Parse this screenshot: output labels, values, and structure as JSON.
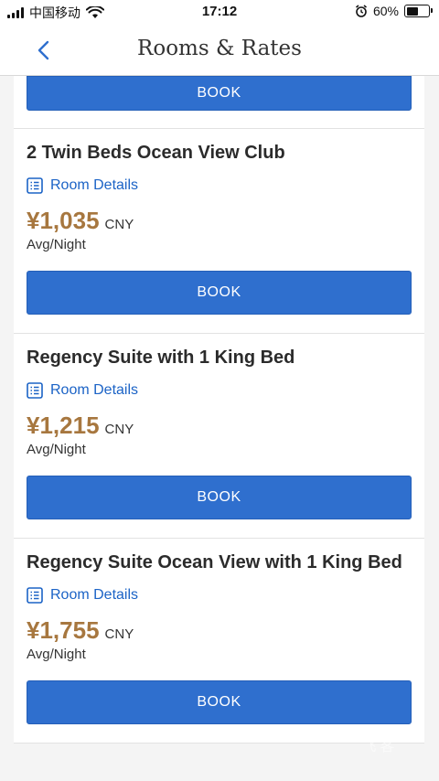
{
  "status_bar": {
    "carrier": "中国移动",
    "time": "17:12",
    "battery": "60%",
    "battery_level": 0.6
  },
  "header": {
    "title": "Rooms & Rates",
    "back_icon": "chevron-left-icon"
  },
  "rooms": [
    {
      "book_label": "BOOK"
    },
    {
      "name": "2 Twin Beds Ocean View Club",
      "details_label": "Room Details",
      "price": "¥1,035",
      "currency": "CNY",
      "per_night": "Avg/Night",
      "book_label": "BOOK"
    },
    {
      "name": "Regency Suite with 1 King Bed",
      "details_label": "Room Details",
      "price": "¥1,215",
      "currency": "CNY",
      "per_night": "Avg/Night",
      "book_label": "BOOK"
    },
    {
      "name": "Regency Suite Ocean View with 1 King Bed",
      "details_label": "Room Details",
      "price": "¥1,755",
      "currency": "CNY",
      "per_night": "Avg/Night",
      "book_label": "BOOK"
    }
  ],
  "watermark": {
    "text": "FLYERT",
    "subtext": "飞客"
  },
  "colors": {
    "accent": "#2f6fce",
    "link": "#1b63c6",
    "price": "#a7773f"
  }
}
